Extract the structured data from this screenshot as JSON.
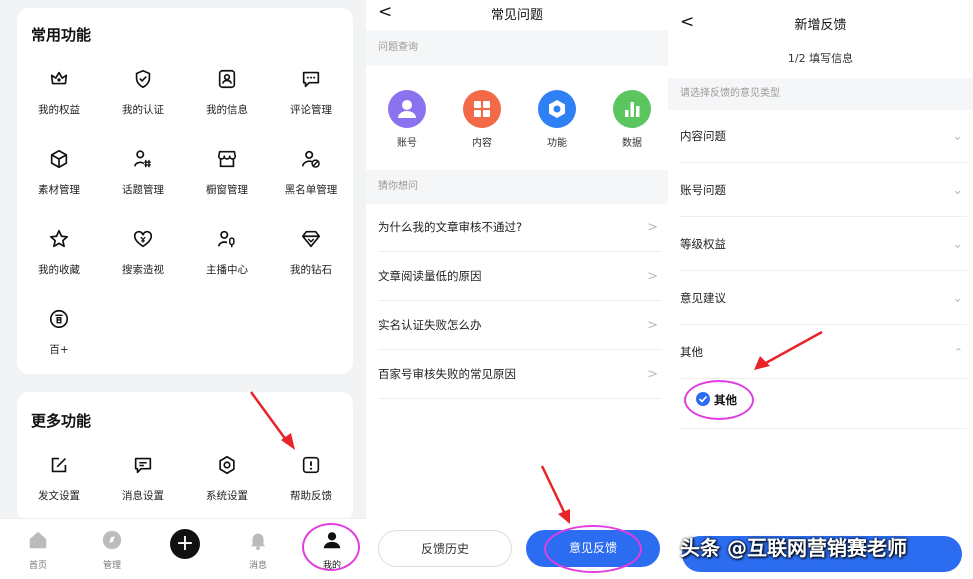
{
  "screen1": {
    "common_title": "常用功能",
    "common_items": [
      {
        "label": "我的权益",
        "icon": "crown-icon"
      },
      {
        "label": "我的认证",
        "icon": "verify-badge-icon"
      },
      {
        "label": "我的信息",
        "icon": "id-card-icon"
      },
      {
        "label": "评论管理",
        "icon": "comment-icon"
      },
      {
        "label": "素材管理",
        "icon": "cube-icon"
      },
      {
        "label": "话题管理",
        "icon": "topic-hash-icon"
      },
      {
        "label": "橱窗管理",
        "icon": "shop-window-icon"
      },
      {
        "label": "黑名单管理",
        "icon": "blacklist-user-icon"
      },
      {
        "label": "我的收藏",
        "icon": "star-icon"
      },
      {
        "label": "搜索造视",
        "icon": "search-spark-icon"
      },
      {
        "label": "主播中心",
        "icon": "anchor-mic-icon"
      },
      {
        "label": "我的钻石",
        "icon": "diamond-icon"
      },
      {
        "label": "百+",
        "icon": "baijia-plus-icon"
      }
    ],
    "more_title": "更多功能",
    "more_items": [
      {
        "label": "发文设置",
        "icon": "edit-icon"
      },
      {
        "label": "消息设置",
        "icon": "message-icon"
      },
      {
        "label": "系统设置",
        "icon": "settings-hex-icon"
      },
      {
        "label": "帮助反馈",
        "icon": "help-feedback-icon"
      }
    ],
    "tabs": [
      {
        "label": "首页",
        "icon": "home-icon"
      },
      {
        "label": "管理",
        "icon": "compass-icon"
      },
      {
        "label": "",
        "icon": "plus-icon"
      },
      {
        "label": "消息",
        "icon": "bell-icon"
      },
      {
        "label": "我的",
        "icon": "user-icon"
      }
    ]
  },
  "screen2": {
    "back": "<",
    "title": "常见问题",
    "query_section": "问题查询",
    "categories": [
      {
        "label": "账号",
        "color": "#8b73f0"
      },
      {
        "label": "内容",
        "color": "#f26a48"
      },
      {
        "label": "功能",
        "color": "#2f7ff5"
      },
      {
        "label": "数据",
        "color": "#5bc65f"
      }
    ],
    "guess_section": "猜你想问",
    "questions": [
      "为什么我的文章审核不通过?",
      "文章阅读量低的原因",
      "实名认证失败怎么办",
      "百家号审核失败的常见原因"
    ],
    "history_button": "反馈历史",
    "feedback_button": "意见反馈"
  },
  "screen3": {
    "back": "<",
    "title": "新增反馈",
    "step": "1/2 填写信息",
    "type_hint": "请选择反馈的意见类型",
    "types": [
      "内容问题",
      "账号问题",
      "等级权益",
      "意见建议",
      "其他"
    ],
    "selected_option": "其他",
    "watermark": "头条 @互联网营销赛老师"
  },
  "colors": {
    "accent": "#2b6cf0",
    "annotation": "#e03ee0",
    "arrow": "#e8242a"
  }
}
